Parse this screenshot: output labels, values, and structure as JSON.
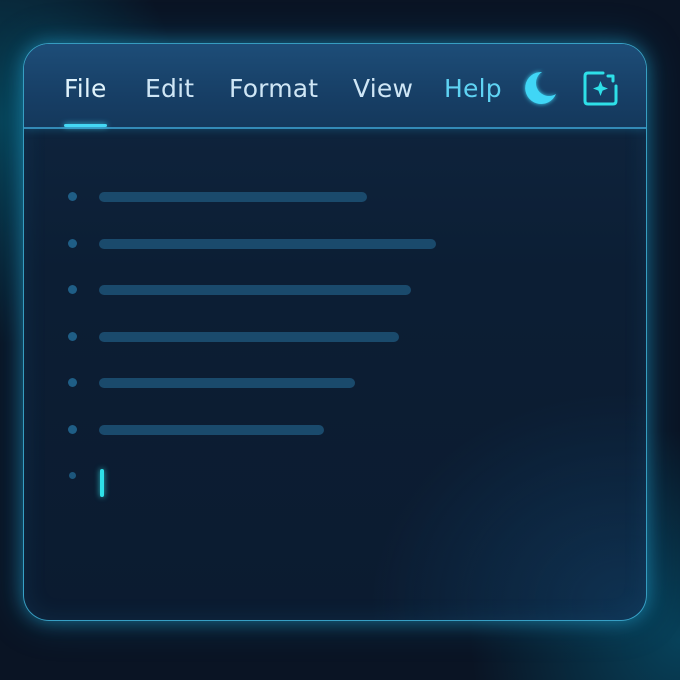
{
  "menubar": {
    "items": [
      {
        "label": "File",
        "active": true
      },
      {
        "label": "Edit"
      },
      {
        "label": "Format"
      },
      {
        "label": "View"
      },
      {
        "label": "Help"
      }
    ],
    "icons": [
      "moon-icon",
      "ai-sparkle-icon"
    ]
  },
  "editor": {
    "lines": [
      {
        "fill": 0.43
      },
      {
        "fill": 0.54
      },
      {
        "fill": 0.5
      },
      {
        "fill": 0.48
      },
      {
        "fill": 0.41
      },
      {
        "fill": 0.36
      }
    ],
    "cursor_line": true
  },
  "colors": {
    "accent": "#44d8f5",
    "menubar": "#1d4d78",
    "background": "#0a1424",
    "help_text": "#5fd3f3"
  }
}
